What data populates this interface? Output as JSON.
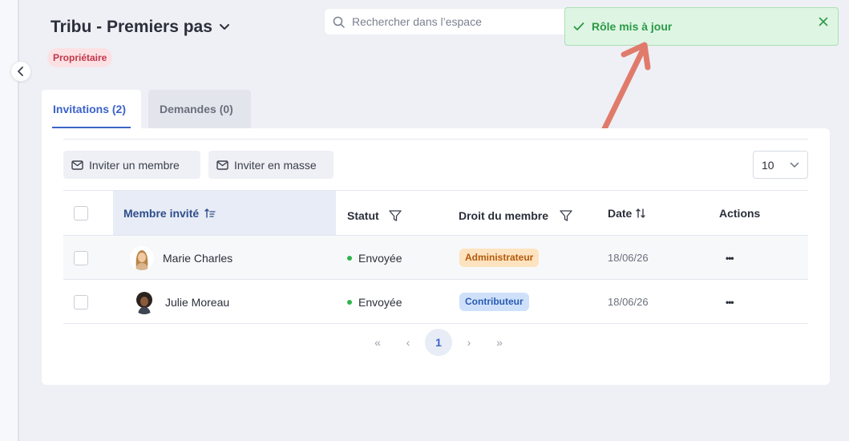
{
  "header": {
    "space_title": "Tribu - Premiers pas",
    "role_badge": "Propriétaire"
  },
  "search": {
    "placeholder": "Rechercher dans l’espace"
  },
  "toast": {
    "message": "Rôle mis à jour",
    "color": "#2a9a47"
  },
  "tabs": [
    {
      "label": "Invitations (2)",
      "active": true
    },
    {
      "label": "Demandes (0)",
      "active": false
    }
  ],
  "toolbar": {
    "invite_label": "Inviter un membre",
    "bulk_label": "Inviter en masse",
    "page_size": "10"
  },
  "table": {
    "columns": {
      "member": "Membre invité",
      "status": "Statut",
      "role": "Droit du membre",
      "date": "Date",
      "actions": "Actions"
    },
    "rows": [
      {
        "name": "Marie Charles",
        "status": "Envoyée",
        "role": "Administrateur",
        "date": "18/06/26",
        "actions": "•••"
      },
      {
        "name": "Julie Moreau",
        "status": "Envoyée",
        "role": "Contributeur",
        "date": "18/06/26",
        "actions": "•••"
      }
    ]
  },
  "pagination": {
    "current": "1",
    "first": "«",
    "prev": "‹",
    "next": "›",
    "last": "»"
  },
  "colors": {
    "accent": "#3b63c9",
    "status_sent": "#2fb44e",
    "admin_badge_bg": "#fde3bf",
    "admin_badge_fg": "#b35a0c",
    "contrib_badge_bg": "#cfe1fa",
    "contrib_badge_fg": "#2a5bb3",
    "annotation_arrow": "#e07b6c"
  }
}
